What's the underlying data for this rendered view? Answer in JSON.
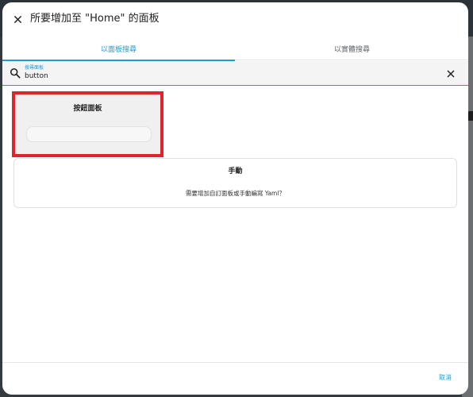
{
  "dialog": {
    "title": "所要增加至 \"Home\" 的面板"
  },
  "tabs": [
    {
      "label": "以面板搜尋",
      "active": true
    },
    {
      "label": "以實體搜尋",
      "active": false
    }
  ],
  "search": {
    "label": "搜尋面板",
    "value": "button"
  },
  "cards": {
    "button_card": {
      "title": "按鈕面板"
    },
    "manual_card": {
      "title": "手動",
      "description": "需要增加自訂面板或手動編寫 Yaml？"
    }
  },
  "footer": {
    "cancel_label": "取消"
  },
  "icons": {
    "close": "close-icon",
    "search": "search-icon",
    "clear": "clear-icon"
  },
  "colors": {
    "accent": "#1c9bd6",
    "highlight": "#e0242d"
  }
}
